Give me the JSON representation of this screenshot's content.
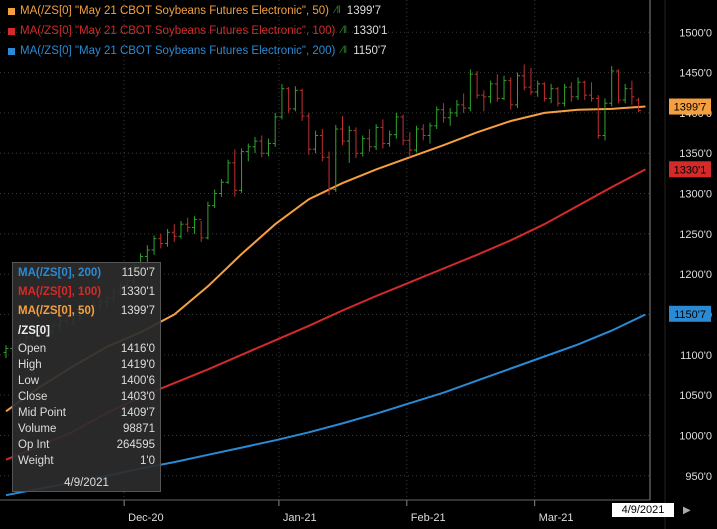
{
  "colors": {
    "background": "#000000",
    "grid": "#3a3a3a",
    "candle_up": "#2fa52f",
    "candle_down": "#c03030",
    "ma50": "#f5a040",
    "ma100": "#d42a2a",
    "ma200": "#2a8ad4"
  },
  "legend": [
    {
      "label": "MA(/ZS[0] \"May 21 CBOT Soybeans Futures Electronic\", 50)",
      "value": "1399'7",
      "color": "#f5a040",
      "glyph": "∕‖"
    },
    {
      "label": "MA(/ZS[0] \"May 21 CBOT Soybeans Futures Electronic\", 100)",
      "value": "1330'1",
      "color": "#d42a2a",
      "glyph": "∕‖"
    },
    {
      "label": "MA(/ZS[0] \"May 21 CBOT Soybeans Futures Electronic\", 200)",
      "value": "1150'7",
      "color": "#2a8ad4",
      "glyph": "∕‖"
    }
  ],
  "tooltip": {
    "ma_rows": [
      {
        "label": "MA(/ZS[0], 200)",
        "value": "1150'7",
        "color": "#2a8ad4"
      },
      {
        "label": "MA(/ZS[0], 100)",
        "value": "1330'1",
        "color": "#d42a2a"
      },
      {
        "label": "MA(/ZS[0], 50)",
        "value": "1399'7",
        "color": "#f5a040"
      }
    ],
    "symbol": "/ZS[0]",
    "rows": [
      {
        "label": "Open",
        "value": "1416'0"
      },
      {
        "label": "High",
        "value": "1419'0"
      },
      {
        "label": "Low",
        "value": "1400'6"
      },
      {
        "label": "Close",
        "value": "1403'0"
      },
      {
        "label": "Mid Point",
        "value": "1409'7"
      },
      {
        "label": "Volume",
        "value": "98871"
      },
      {
        "label": "Op Int",
        "value": "264595"
      },
      {
        "label": "Weight",
        "value": "1'0"
      }
    ],
    "date": "4/9/2021"
  },
  "cursor_date": "4/9/2021",
  "price_tags": [
    {
      "price": 1407.9,
      "text": "1399'7",
      "color": "#f5a040"
    },
    {
      "price": 1330.1,
      "text": "1330'1",
      "color": "#d42a2a"
    },
    {
      "price": 1150.9,
      "text": "1150'7",
      "color": "#2a8ad4"
    }
  ],
  "chart_data": {
    "type": "candlestick",
    "ylim": [
      920,
      1540
    ],
    "y_ticks": [
      {
        "value": 950,
        "label": "950'0"
      },
      {
        "value": 1000,
        "label": "1000'0"
      },
      {
        "value": 1050,
        "label": "1050'0"
      },
      {
        "value": 1100,
        "label": "1100'0"
      },
      {
        "value": 1150,
        "label": "1150'0"
      },
      {
        "value": 1200,
        "label": "1200'0"
      },
      {
        "value": 1250,
        "label": "1250'0"
      },
      {
        "value": 1300,
        "label": "1300'0"
      },
      {
        "value": 1350,
        "label": "1350'0"
      },
      {
        "value": 1400,
        "label": "1400'0"
      },
      {
        "value": 1450,
        "label": "1450'0"
      },
      {
        "value": 1500,
        "label": "1500'0"
      }
    ],
    "x_ticks": [
      {
        "bar": 18,
        "label": "Dec-20"
      },
      {
        "bar": 41,
        "label": "Jan-21"
      },
      {
        "bar": 60,
        "label": "Feb-21"
      },
      {
        "bar": 79,
        "label": "Mar-21"
      }
    ],
    "bars": [
      {
        "o": 1103,
        "h": 1112,
        "l": 1096,
        "c": 1108
      },
      {
        "o": 1108,
        "h": 1118,
        "l": 1104,
        "c": 1115
      },
      {
        "o": 1115,
        "h": 1120,
        "l": 1108,
        "c": 1112
      },
      {
        "o": 1112,
        "h": 1125,
        "l": 1110,
        "c": 1122
      },
      {
        "o": 1122,
        "h": 1130,
        "l": 1118,
        "c": 1127
      },
      {
        "o": 1127,
        "h": 1135,
        "l": 1121,
        "c": 1131
      },
      {
        "o": 1131,
        "h": 1138,
        "l": 1124,
        "c": 1128
      },
      {
        "o": 1128,
        "h": 1140,
        "l": 1126,
        "c": 1137
      },
      {
        "o": 1137,
        "h": 1145,
        "l": 1131,
        "c": 1142
      },
      {
        "o": 1142,
        "h": 1148,
        "l": 1134,
        "c": 1139
      },
      {
        "o": 1139,
        "h": 1152,
        "l": 1137,
        "c": 1149
      },
      {
        "o": 1149,
        "h": 1158,
        "l": 1143,
        "c": 1154
      },
      {
        "o": 1154,
        "h": 1162,
        "l": 1148,
        "c": 1158
      },
      {
        "o": 1158,
        "h": 1166,
        "l": 1150,
        "c": 1161
      },
      {
        "o": 1161,
        "h": 1170,
        "l": 1155,
        "c": 1166
      },
      {
        "o": 1166,
        "h": 1174,
        "l": 1158,
        "c": 1170
      },
      {
        "o": 1170,
        "h": 1182,
        "l": 1166,
        "c": 1178
      },
      {
        "o": 1178,
        "h": 1190,
        "l": 1174,
        "c": 1186
      },
      {
        "o": 1186,
        "h": 1196,
        "l": 1180,
        "c": 1192
      },
      {
        "o": 1192,
        "h": 1214,
        "l": 1188,
        "c": 1210
      },
      {
        "o": 1210,
        "h": 1226,
        "l": 1205,
        "c": 1222
      },
      {
        "o": 1222,
        "h": 1236,
        "l": 1215,
        "c": 1230
      },
      {
        "o": 1230,
        "h": 1248,
        "l": 1224,
        "c": 1244
      },
      {
        "o": 1244,
        "h": 1250,
        "l": 1232,
        "c": 1238
      },
      {
        "o": 1238,
        "h": 1256,
        "l": 1234,
        "c": 1252
      },
      {
        "o": 1252,
        "h": 1262,
        "l": 1240,
        "c": 1247
      },
      {
        "o": 1247,
        "h": 1266,
        "l": 1244,
        "c": 1262
      },
      {
        "o": 1262,
        "h": 1270,
        "l": 1252,
        "c": 1258
      },
      {
        "o": 1258,
        "h": 1272,
        "l": 1250,
        "c": 1268
      },
      {
        "o": 1268,
        "h": 1266,
        "l": 1240,
        "c": 1245
      },
      {
        "o": 1245,
        "h": 1290,
        "l": 1243,
        "c": 1285
      },
      {
        "o": 1285,
        "h": 1305,
        "l": 1282,
        "c": 1300
      },
      {
        "o": 1300,
        "h": 1318,
        "l": 1296,
        "c": 1314
      },
      {
        "o": 1314,
        "h": 1342,
        "l": 1312,
        "c": 1338
      },
      {
        "o": 1338,
        "h": 1355,
        "l": 1296,
        "c": 1304
      },
      {
        "o": 1304,
        "h": 1356,
        "l": 1301,
        "c": 1352
      },
      {
        "o": 1352,
        "h": 1362,
        "l": 1340,
        "c": 1358
      },
      {
        "o": 1358,
        "h": 1370,
        "l": 1350,
        "c": 1365
      },
      {
        "o": 1365,
        "h": 1372,
        "l": 1345,
        "c": 1350
      },
      {
        "o": 1350,
        "h": 1368,
        "l": 1346,
        "c": 1362
      },
      {
        "o": 1362,
        "h": 1400,
        "l": 1358,
        "c": 1395
      },
      {
        "o": 1395,
        "h": 1436,
        "l": 1392,
        "c": 1430
      },
      {
        "o": 1430,
        "h": 1432,
        "l": 1400,
        "c": 1405
      },
      {
        "o": 1405,
        "h": 1433,
        "l": 1402,
        "c": 1428
      },
      {
        "o": 1428,
        "h": 1430,
        "l": 1390,
        "c": 1396
      },
      {
        "o": 1396,
        "h": 1400,
        "l": 1348,
        "c": 1355
      },
      {
        "o": 1355,
        "h": 1378,
        "l": 1350,
        "c": 1372
      },
      {
        "o": 1372,
        "h": 1380,
        "l": 1340,
        "c": 1345
      },
      {
        "o": 1345,
        "h": 1352,
        "l": 1298,
        "c": 1305
      },
      {
        "o": 1305,
        "h": 1385,
        "l": 1302,
        "c": 1380
      },
      {
        "o": 1380,
        "h": 1396,
        "l": 1360,
        "c": 1365
      },
      {
        "o": 1365,
        "h": 1384,
        "l": 1338,
        "c": 1378
      },
      {
        "o": 1378,
        "h": 1382,
        "l": 1344,
        "c": 1350
      },
      {
        "o": 1350,
        "h": 1372,
        "l": 1346,
        "c": 1368
      },
      {
        "o": 1368,
        "h": 1380,
        "l": 1352,
        "c": 1358
      },
      {
        "o": 1358,
        "h": 1386,
        "l": 1354,
        "c": 1382
      },
      {
        "o": 1382,
        "h": 1392,
        "l": 1356,
        "c": 1362
      },
      {
        "o": 1362,
        "h": 1378,
        "l": 1358,
        "c": 1373
      },
      {
        "o": 1373,
        "h": 1400,
        "l": 1368,
        "c": 1395
      },
      {
        "o": 1395,
        "h": 1398,
        "l": 1360,
        "c": 1366
      },
      {
        "o": 1366,
        "h": 1376,
        "l": 1345,
        "c": 1354
      },
      {
        "o": 1354,
        "h": 1384,
        "l": 1351,
        "c": 1380
      },
      {
        "o": 1380,
        "h": 1386,
        "l": 1366,
        "c": 1372
      },
      {
        "o": 1372,
        "h": 1388,
        "l": 1362,
        "c": 1384
      },
      {
        "o": 1384,
        "h": 1408,
        "l": 1380,
        "c": 1404
      },
      {
        "o": 1404,
        "h": 1412,
        "l": 1388,
        "c": 1394
      },
      {
        "o": 1394,
        "h": 1406,
        "l": 1384,
        "c": 1400
      },
      {
        "o": 1400,
        "h": 1416,
        "l": 1395,
        "c": 1410
      },
      {
        "o": 1410,
        "h": 1424,
        "l": 1400,
        "c": 1406
      },
      {
        "o": 1406,
        "h": 1454,
        "l": 1402,
        "c": 1448
      },
      {
        "o": 1448,
        "h": 1452,
        "l": 1418,
        "c": 1422
      },
      {
        "o": 1422,
        "h": 1428,
        "l": 1402,
        "c": 1420
      },
      {
        "o": 1420,
        "h": 1440,
        "l": 1412,
        "c": 1436
      },
      {
        "o": 1436,
        "h": 1448,
        "l": 1414,
        "c": 1418
      },
      {
        "o": 1418,
        "h": 1446,
        "l": 1416,
        "c": 1440
      },
      {
        "o": 1440,
        "h": 1444,
        "l": 1404,
        "c": 1410
      },
      {
        "o": 1410,
        "h": 1450,
        "l": 1406,
        "c": 1446
      },
      {
        "o": 1446,
        "h": 1460,
        "l": 1428,
        "c": 1432
      },
      {
        "o": 1432,
        "h": 1456,
        "l": 1422,
        "c": 1426
      },
      {
        "o": 1426,
        "h": 1440,
        "l": 1420,
        "c": 1436
      },
      {
        "o": 1436,
        "h": 1438,
        "l": 1414,
        "c": 1418
      },
      {
        "o": 1418,
        "h": 1436,
        "l": 1412,
        "c": 1430
      },
      {
        "o": 1430,
        "h": 1432,
        "l": 1408,
        "c": 1412
      },
      {
        "o": 1412,
        "h": 1436,
        "l": 1408,
        "c": 1432
      },
      {
        "o": 1432,
        "h": 1438,
        "l": 1414,
        "c": 1420
      },
      {
        "o": 1420,
        "h": 1444,
        "l": 1416,
        "c": 1438
      },
      {
        "o": 1438,
        "h": 1440,
        "l": 1416,
        "c": 1422
      },
      {
        "o": 1422,
        "h": 1438,
        "l": 1414,
        "c": 1418
      },
      {
        "o": 1418,
        "h": 1422,
        "l": 1368,
        "c": 1372
      },
      {
        "o": 1372,
        "h": 1418,
        "l": 1366,
        "c": 1412
      },
      {
        "o": 1412,
        "h": 1458,
        "l": 1408,
        "c": 1452
      },
      {
        "o": 1452,
        "h": 1454,
        "l": 1412,
        "c": 1416
      },
      {
        "o": 1416,
        "h": 1436,
        "l": 1412,
        "c": 1430
      },
      {
        "o": 1430,
        "h": 1440,
        "l": 1410,
        "c": 1420
      },
      {
        "o": 1416,
        "h": 1419,
        "l": 1400.75,
        "c": 1403
      }
    ],
    "series": [
      {
        "name": "MA(/ZS[0], 50)",
        "color": "#f5a040",
        "points": [
          [
            0,
            1030
          ],
          [
            5,
            1060
          ],
          [
            10,
            1086
          ],
          [
            15,
            1110
          ],
          [
            20,
            1128
          ],
          [
            25,
            1150
          ],
          [
            30,
            1185
          ],
          [
            35,
            1225
          ],
          [
            40,
            1262
          ],
          [
            45,
            1293
          ],
          [
            50,
            1313
          ],
          [
            55,
            1330
          ],
          [
            60,
            1345
          ],
          [
            65,
            1360
          ],
          [
            70,
            1376
          ],
          [
            75,
            1390
          ],
          [
            80,
            1400
          ],
          [
            85,
            1404
          ],
          [
            90,
            1405
          ],
          [
            95,
            1408
          ]
        ]
      },
      {
        "name": "MA(/ZS[0], 100)",
        "color": "#d42a2a",
        "points": [
          [
            0,
            970
          ],
          [
            5,
            987
          ],
          [
            10,
            1005
          ],
          [
            15,
            1028
          ],
          [
            20,
            1048
          ],
          [
            25,
            1065
          ],
          [
            30,
            1082
          ],
          [
            35,
            1100
          ],
          [
            40,
            1118
          ],
          [
            45,
            1136
          ],
          [
            50,
            1155
          ],
          [
            55,
            1173
          ],
          [
            60,
            1190
          ],
          [
            65,
            1207
          ],
          [
            70,
            1224
          ],
          [
            75,
            1242
          ],
          [
            80,
            1262
          ],
          [
            85,
            1285
          ],
          [
            90,
            1308
          ],
          [
            95,
            1330
          ]
        ]
      },
      {
        "name": "MA(/ZS[0], 200)",
        "color": "#2a8ad4",
        "points": [
          [
            0,
            926
          ],
          [
            5,
            934
          ],
          [
            10,
            942
          ],
          [
            15,
            950
          ],
          [
            20,
            959
          ],
          [
            25,
            967
          ],
          [
            30,
            976
          ],
          [
            35,
            985
          ],
          [
            40,
            994
          ],
          [
            45,
            1004
          ],
          [
            50,
            1015
          ],
          [
            55,
            1027
          ],
          [
            60,
            1040
          ],
          [
            65,
            1053
          ],
          [
            70,
            1068
          ],
          [
            75,
            1083
          ],
          [
            80,
            1098
          ],
          [
            85,
            1113
          ],
          [
            90,
            1130
          ],
          [
            95,
            1150
          ]
        ]
      }
    ]
  }
}
